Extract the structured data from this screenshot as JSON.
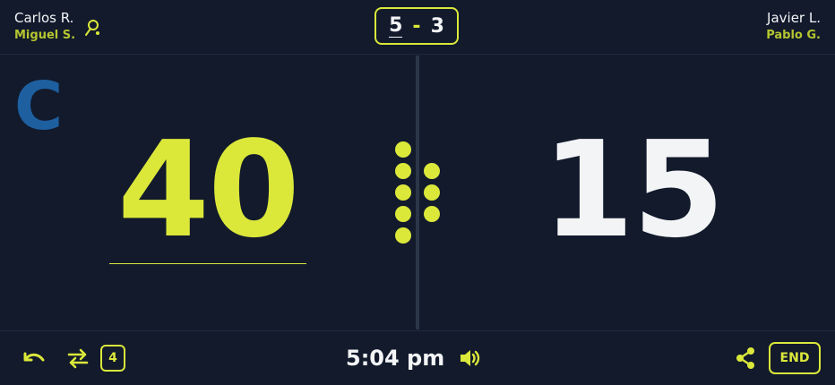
{
  "team_left": {
    "player1": "Carlos R.",
    "player2": "Miguel S."
  },
  "team_right": {
    "player1": "Javier L.",
    "player2": "Pablo G."
  },
  "sets": {
    "left": "5",
    "separator": "-",
    "right": "3"
  },
  "court_letter": "C",
  "points": {
    "left": "40",
    "right": "15"
  },
  "pagination_dots": {
    "left_column": 5,
    "right_column": 3
  },
  "bottom": {
    "undo_icon": "undo-icon",
    "swap_icon": "swap-icon",
    "badge_count": "4",
    "time": "5:04 pm",
    "sound_icon": "speaker-icon",
    "share_icon": "share-icon",
    "end_label": "END"
  },
  "colors": {
    "accent": "#dbe83a",
    "background": "#121a2c",
    "court": "#1e5fa0"
  }
}
